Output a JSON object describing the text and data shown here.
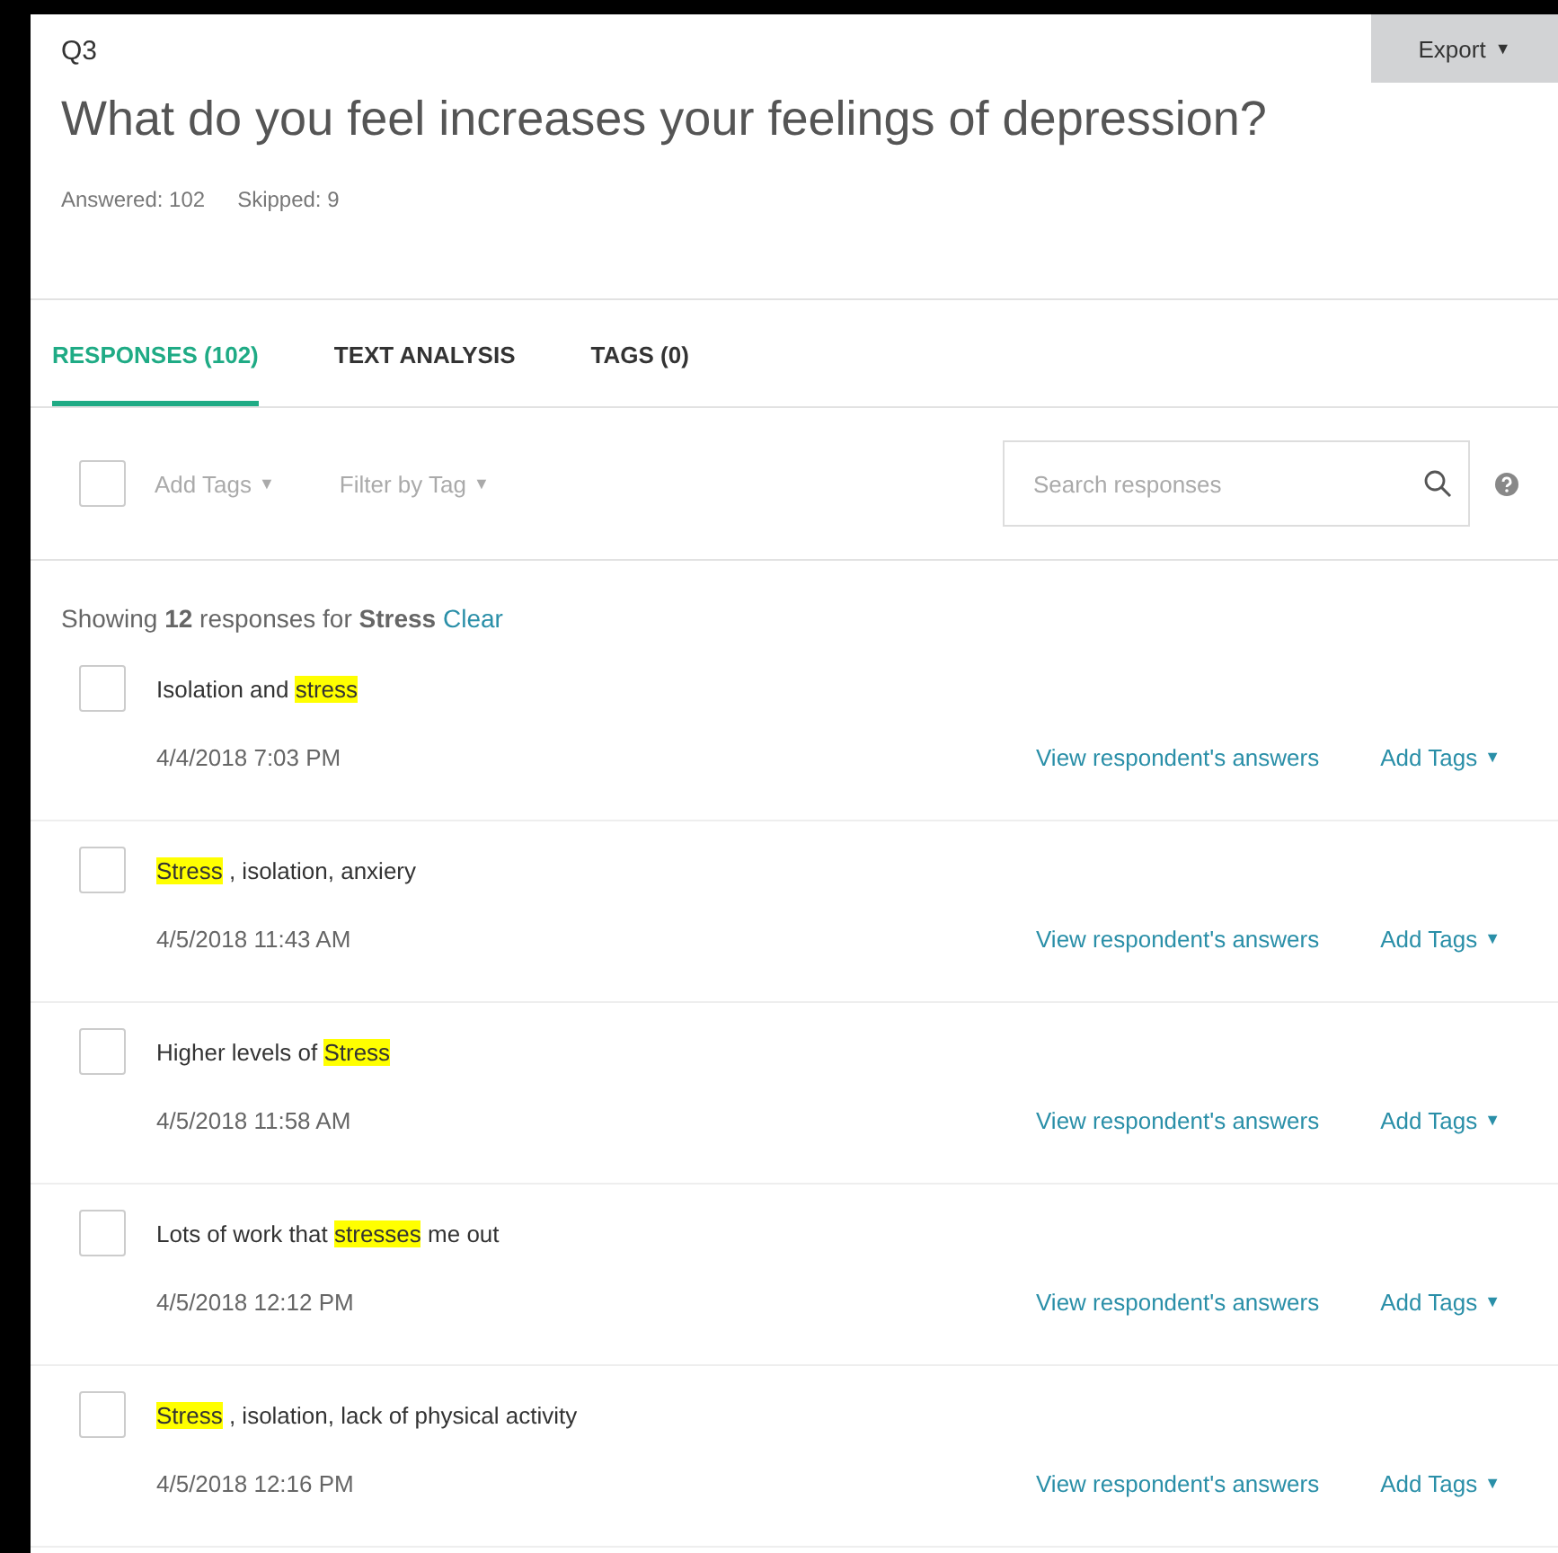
{
  "question": {
    "number": "Q3",
    "title": "What do you feel increases your feelings of depression?",
    "answered": "Answered: 102",
    "skipped": "Skipped: 9"
  },
  "export_button": {
    "label": "Export",
    "caret": "▼"
  },
  "tabs": [
    {
      "label": "RESPONSES (102)",
      "selected": true
    },
    {
      "label": "TEXT ANALYSIS",
      "selected": false
    },
    {
      "label": "TAGS (0)",
      "selected": false
    }
  ],
  "toolbar": {
    "select_all_checked": false,
    "add_tags": "Add Tags",
    "filter_by_tag": "Filter by Tag",
    "caret": "▼",
    "search_placeholder": "Search responses"
  },
  "filter_summary": {
    "text": "Showing **12** responses for **Stress**",
    "clear_link": "Clear"
  },
  "responses": [
    {
      "checked": false,
      "segments": [
        {
          "text": "Isolation and ",
          "highlighted": false
        },
        {
          "text": "stress",
          "highlighted": true
        }
      ],
      "date": "4/4/2018 7:03 PM",
      "view_link": "View respondent's answers",
      "add_tags": "Add Tags",
      "caret": "▼"
    },
    {
      "checked": false,
      "segments": [
        {
          "text": "Stress",
          "highlighted": true
        },
        {
          "text": " , isolation, anxiery",
          "highlighted": false
        }
      ],
      "date": "4/5/2018 11:43 AM",
      "view_link": "View respondent's answers",
      "add_tags": "Add Tags",
      "caret": "▼"
    },
    {
      "checked": false,
      "segments": [
        {
          "text": "Higher levels of ",
          "highlighted": false
        },
        {
          "text": "Stress",
          "highlighted": true
        }
      ],
      "date": "4/5/2018 11:58 AM",
      "view_link": "View respondent's answers",
      "add_tags": "Add Tags",
      "caret": "▼"
    },
    {
      "checked": false,
      "segments": [
        {
          "text": "Lots of work that ",
          "highlighted": false
        },
        {
          "text": "stresses",
          "highlighted": true
        },
        {
          "text": " me out",
          "highlighted": false
        }
      ],
      "date": "4/5/2018 12:12 PM",
      "view_link": "View respondent's answers",
      "add_tags": "Add Tags",
      "caret": "▼"
    },
    {
      "checked": false,
      "segments": [
        {
          "text": "Stress",
          "highlighted": true
        },
        {
          "text": " , isolation, lack of physical activity",
          "highlighted": false
        }
      ],
      "date": "4/5/2018 12:16 PM",
      "view_link": "View respondent's answers",
      "add_tags": "Add Tags",
      "caret": "▼"
    }
  ]
}
